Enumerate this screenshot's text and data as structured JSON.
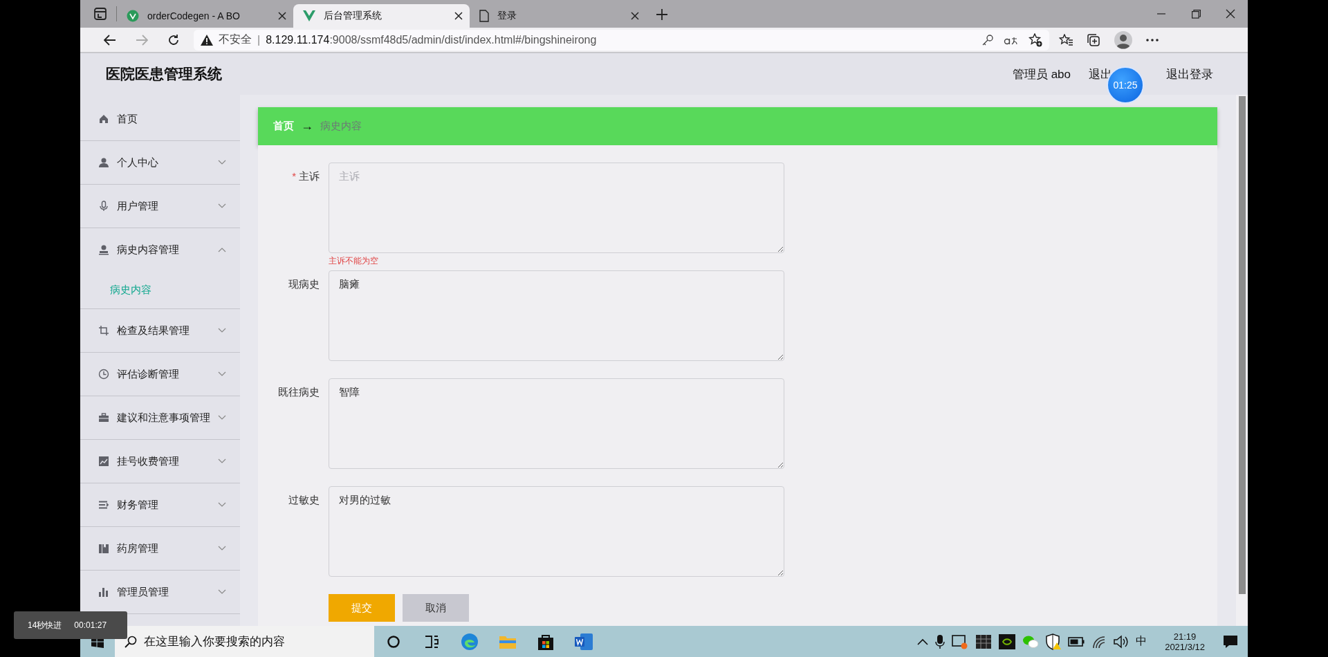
{
  "browser": {
    "tabs": [
      {
        "title": "orderCodegen - A BO",
        "selected": false,
        "kind": "vue"
      },
      {
        "title": "后台管理系统",
        "selected": true,
        "kind": "vue"
      },
      {
        "title": "登录",
        "selected": false,
        "kind": "page"
      }
    ],
    "security": "不安全",
    "separator": "|",
    "url_host": "8.129.11.174",
    "url_rest": ":9008/ssmf48d5/admin/dist/index.html#/bingshineirong"
  },
  "header": {
    "title": "医院医患管理系统",
    "user": "管理员 abo",
    "links": [
      "退出",
      "退出登录"
    ]
  },
  "sidebar": {
    "items": [
      {
        "label": "首页"
      },
      {
        "label": "个人中心",
        "expanded": false
      },
      {
        "label": "用户管理",
        "expanded": false
      },
      {
        "label": "病史内容管理",
        "expanded": true,
        "children": [
          {
            "label": "病史内容",
            "selected": true
          }
        ]
      },
      {
        "label": "检查及结果管理",
        "expanded": false
      },
      {
        "label": "评估诊断管理",
        "expanded": false
      },
      {
        "label": "建议和注意事项管理",
        "expanded": false
      },
      {
        "label": "挂号收费管理",
        "expanded": false
      },
      {
        "label": "财务管理",
        "expanded": false
      },
      {
        "label": "药房管理",
        "expanded": false
      },
      {
        "label": "管理员管理",
        "expanded": false
      }
    ]
  },
  "breadcrumb": {
    "home": "首页",
    "separator": "→",
    "current": "病史内容"
  },
  "form": {
    "fields": [
      {
        "label": "主诉",
        "required_mark": "*",
        "placeholder": "主诉",
        "error": "主诉不能为空"
      },
      {
        "label": "现病史",
        "value": "脑瘫"
      },
      {
        "label": "既往病史",
        "value": "智障"
      },
      {
        "label": "过敏史",
        "value": "对男的过敏"
      }
    ],
    "buttons": [
      {
        "label": "提交",
        "kind": "primary"
      },
      {
        "label": "取消",
        "kind": "default"
      }
    ]
  },
  "taskbar": {
    "search_placeholder": "在这里输入你要搜索的内容",
    "ime": "中",
    "time": "21:19",
    "date": "2021/3/12"
  },
  "overlays": {
    "timer": "01:25",
    "playback_label": "14秒快进",
    "playback_time": "00:01:27"
  }
}
